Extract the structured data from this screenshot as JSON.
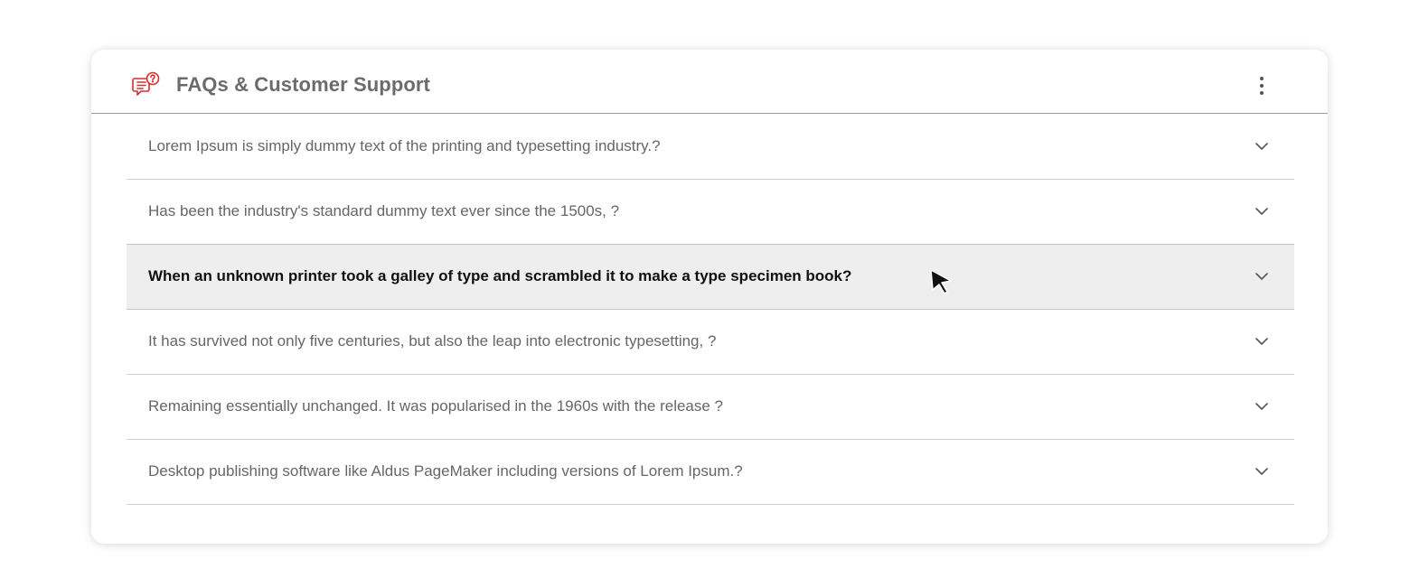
{
  "header": {
    "title": "FAQs & Customer Support",
    "icon": "faq-chat-icon",
    "menu_icon": "more-vertical-icon"
  },
  "colors": {
    "accent": "#d32f2f",
    "title_text": "#6b6b6b",
    "question_text": "#666666",
    "active_text": "#111111",
    "active_background": "#eeeeee"
  },
  "faqs": [
    {
      "question": "Lorem Ipsum is simply dummy text of the printing and typesetting industry.?",
      "expanded": false,
      "hovered": false
    },
    {
      "question": "Has been the industry's standard dummy text ever since the 1500s, ?",
      "expanded": false,
      "hovered": false
    },
    {
      "question": "When an unknown printer took a galley of type and scrambled it to make a type specimen book?",
      "expanded": false,
      "hovered": true
    },
    {
      "question": "It has survived not only five centuries, but also the leap into electronic typesetting, ?",
      "expanded": false,
      "hovered": false
    },
    {
      "question": "Remaining essentially unchanged. It was popularised in the 1960s with the release ?",
      "expanded": false,
      "hovered": false
    },
    {
      "question": "Desktop publishing software like Aldus PageMaker including versions of Lorem Ipsum.?",
      "expanded": false,
      "hovered": false
    }
  ]
}
